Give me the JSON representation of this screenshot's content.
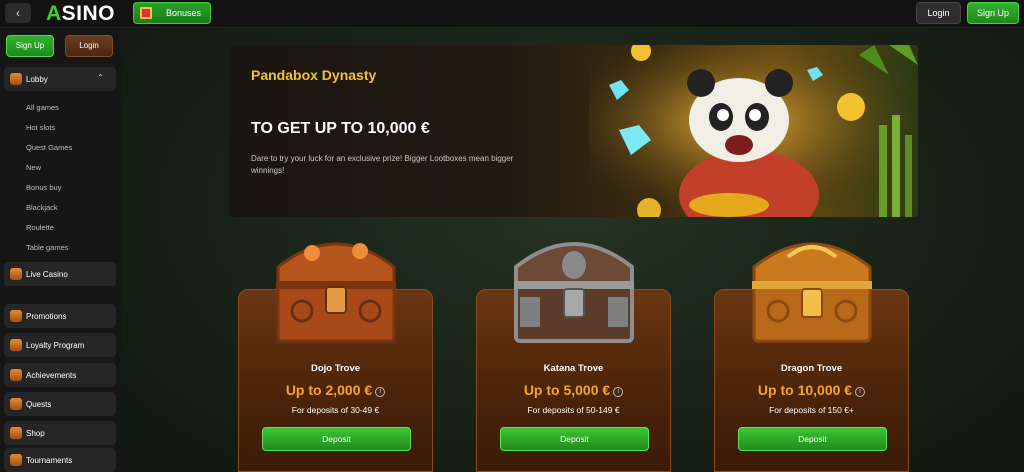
{
  "topbar": {
    "back_icon": "chevron-left-icon",
    "logo_accent": "A",
    "logo_rest": "SINO",
    "bonuses_label": "Bonuses",
    "login_label": "Login",
    "signup_label": "Sign Up"
  },
  "sidebar": {
    "signup_label": "Sign Up",
    "login_label": "Login",
    "lobby": {
      "label": "Lobby",
      "icon": "lobby-icon"
    },
    "lobby_items": [
      "All games",
      "Hot slots",
      "Quest Games",
      "New",
      "Bonus buy",
      "Blackjack",
      "Roulette",
      "Table games"
    ],
    "sections": [
      {
        "label": "Live Casino",
        "icon": "live-casino-icon"
      },
      {
        "label": "Promotions",
        "icon": "megaphone-icon"
      },
      {
        "label": "Loyalty Program",
        "icon": "medal-icon"
      },
      {
        "label": "Achievements",
        "icon": "target-icon"
      },
      {
        "label": "Quests",
        "icon": "book-icon"
      },
      {
        "label": "Shop",
        "icon": "shop-icon"
      },
      {
        "label": "Tournaments",
        "icon": "trophy-icon"
      }
    ]
  },
  "banner": {
    "title": "Pandabox Dynasty",
    "headline": "TO GET UP TO 10,000 €",
    "description": "Dare to try your luck for an exclusive prize! Bigger Lootboxes mean bigger winnings!"
  },
  "troves": [
    {
      "name": "Dojo Trove",
      "amount": "Up to 2,000 €",
      "deposits": "For deposits of 30-49 €",
      "button": "Deposit"
    },
    {
      "name": "Katana Trove",
      "amount": "Up to 5,000 €",
      "deposits": "For deposits of 50-149 €",
      "button": "Deposit"
    },
    {
      "name": "Dragon Trove",
      "amount": "Up to 10,000 €",
      "deposits": "For deposits of 150 €+",
      "button": "Deposit"
    }
  ],
  "colors": {
    "brand_green": "#33b22f",
    "accent_orange": "#f5a623",
    "banner_title": "#f2c233"
  }
}
